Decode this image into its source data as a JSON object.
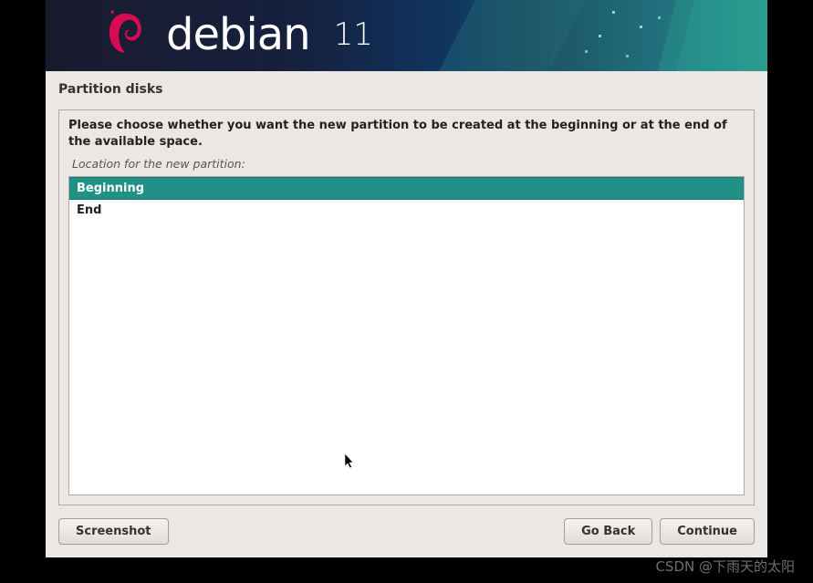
{
  "brand": {
    "name": "debian",
    "version": "11"
  },
  "page": {
    "title": "Partition disks",
    "instruction": "Please choose whether you want the new partition to be created at the beginning or at the end of the available space.",
    "list_label": "Location for the new partition:"
  },
  "options": [
    {
      "label": "Beginning",
      "selected": true
    },
    {
      "label": "End",
      "selected": false
    }
  ],
  "buttons": {
    "screenshot": "Screenshot",
    "go_back": "Go Back",
    "continue": "Continue"
  },
  "watermark": "CSDN @下雨天的太阳"
}
